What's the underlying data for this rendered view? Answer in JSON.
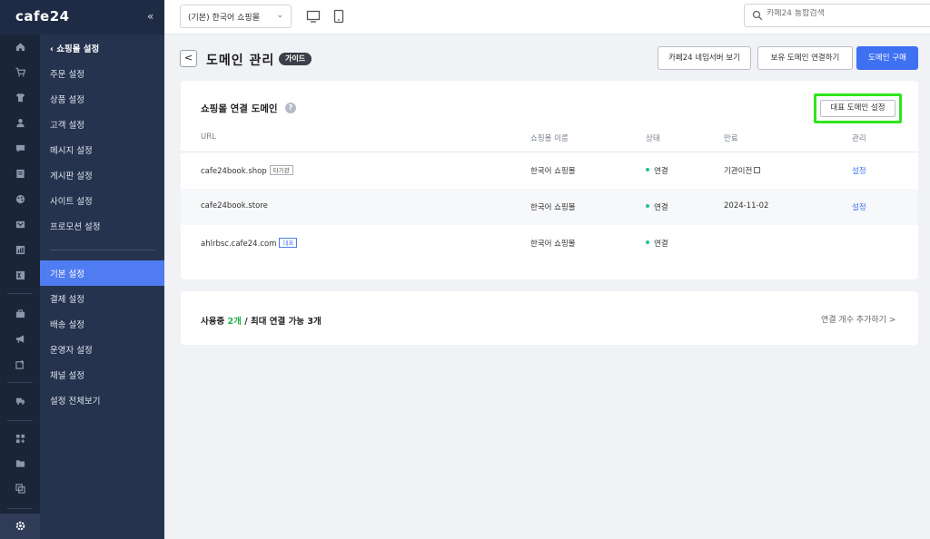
{
  "topbar": {
    "logo": "cafe24",
    "collapse": "«",
    "shop_select": "(기본) 한국어 쇼핑몰",
    "search_placeholder": "카페24 통합검색"
  },
  "icon_names": [
    "home-icon",
    "cart-icon",
    "shirt-icon",
    "user-icon",
    "chat-icon",
    "board-icon",
    "palette-icon",
    "promo-icon",
    "chart-icon",
    "excel-icon",
    "store-icon",
    "megaphone-icon",
    "app-store-icon",
    "truck-icon",
    "grid-icon",
    "folder-icon",
    "copy-icon",
    "gear-icon"
  ],
  "menu": {
    "header": "쇼핑몰 설정",
    "items_top": [
      "주문 설정",
      "상품 설정",
      "고객 설정",
      "메시지 설정",
      "게시판 설정",
      "사이트 설정",
      "프로모션 설정"
    ],
    "items_bottom": [
      "기본 설정",
      "결제 설정",
      "배송 설정",
      "운영자 설정",
      "채널 설정",
      "설정 전체보기"
    ],
    "active": "기본 설정"
  },
  "page": {
    "back": "<",
    "title": "도메인 관리",
    "guide": "가이드",
    "buttons": {
      "nameserver": "카페24 네임서버 보기",
      "connect": "보유 도메인 연결하기",
      "buy": "도메인 구매"
    }
  },
  "domains": {
    "title": "쇼핑몰 연결 도메인",
    "help": "?",
    "rep_button": "대표 도메인 설정",
    "columns": [
      "URL",
      "쇼핑몰 이름",
      "상태",
      "만료",
      "관리"
    ],
    "rows": [
      {
        "url": "cafe24book.shop",
        "tag": "타기관",
        "shop": "한국어 쇼핑몰",
        "status": "연결",
        "expiry": "기관이전",
        "manage": "설정"
      },
      {
        "url": "cafe24book.store",
        "tag": "",
        "shop": "한국어 쇼핑몰",
        "status": "연결",
        "expiry": "2024-11-02",
        "manage": "설정"
      },
      {
        "url": "ahlrbsc.cafe24.com",
        "tag": "대표",
        "shop": "한국어 쇼핑몰",
        "status": "연결",
        "expiry": "",
        "manage": ""
      }
    ]
  },
  "usage": {
    "prefix": "사용중",
    "count": "2개",
    "suffix": "/ 최대 연결 가능 3개",
    "add_link": "연결 개수 추가하기 >"
  },
  "colors": {
    "accent": "#3d71f2",
    "sidebar": "#26334f",
    "highlight": "#2ee51c",
    "status_dot": "#22c19a"
  }
}
